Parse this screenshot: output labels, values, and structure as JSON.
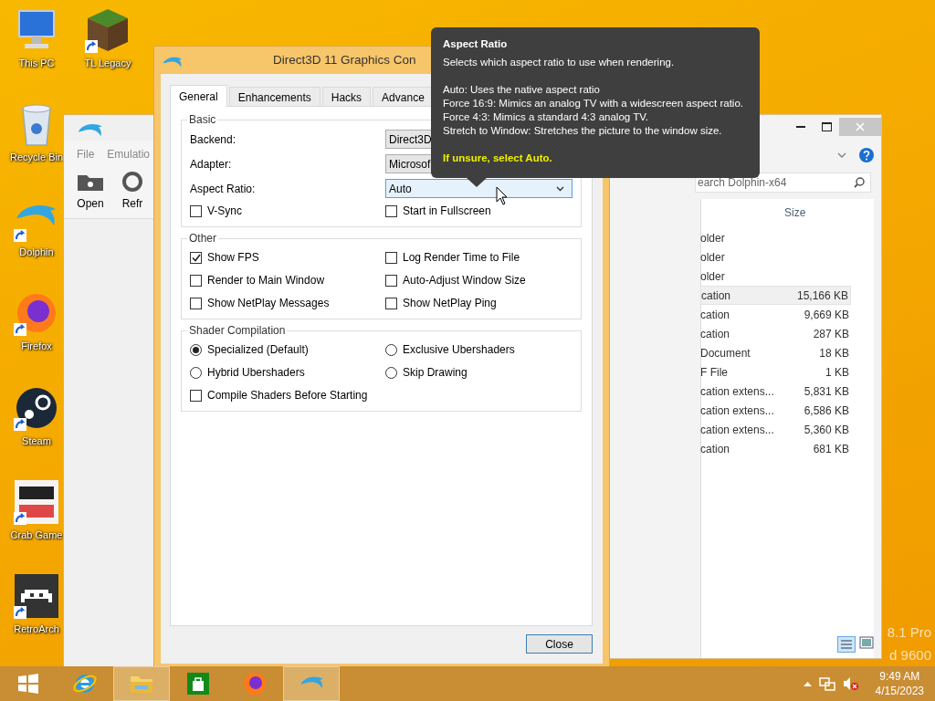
{
  "desktop_icons": [
    {
      "label": "This PC",
      "kind": "pc",
      "shortcut": false
    },
    {
      "label": "TL Legacy",
      "kind": "block",
      "shortcut": true
    },
    {
      "label": "Recycle Bin",
      "kind": "bin",
      "shortcut": false
    },
    {
      "label": "Dolphin",
      "kind": "dolphin",
      "shortcut": true
    },
    {
      "label": "Firefox",
      "kind": "firefox",
      "shortcut": true
    },
    {
      "label": "Steam",
      "kind": "steam",
      "shortcut": true
    },
    {
      "label": "Crab Game",
      "kind": "crab",
      "shortcut": true
    },
    {
      "label": "RetroArch",
      "kind": "retro",
      "shortcut": true
    }
  ],
  "os_build_text": [
    "8.1 Pro",
    "d 9600"
  ],
  "dolphin_window": {
    "menu": [
      "File",
      "Emulatio"
    ],
    "toolbar": [
      {
        "label": "Open",
        "kind": "open"
      },
      {
        "label": "Refr",
        "kind": "refresh"
      }
    ]
  },
  "explorer_window": {
    "search_placeholder": "earch Dolphin-x64",
    "columns": [
      "Size"
    ],
    "rows": [
      {
        "type": "older",
        "selected": false
      },
      {
        "type": "older",
        "selected": false
      },
      {
        "type": "older",
        "selected": false
      },
      {
        "type": "cation",
        "size": "15,166 KB",
        "selected": true
      },
      {
        "type": "cation",
        "size": "9,669 KB",
        "selected": false
      },
      {
        "type": "cation",
        "size": "287 KB",
        "selected": false
      },
      {
        "type": "Document",
        "size": "18 KB",
        "selected": false
      },
      {
        "type": "F File",
        "size": "1 KB",
        "selected": false
      },
      {
        "type": "cation extens...",
        "size": "5,831 KB",
        "selected": false
      },
      {
        "type": "cation extens...",
        "size": "6,586 KB",
        "selected": false
      },
      {
        "type": "cation extens...",
        "size": "5,360 KB",
        "selected": false
      },
      {
        "type": "cation",
        "size": "681 KB",
        "selected": false
      }
    ]
  },
  "dialog": {
    "title": "Direct3D 11 Graphics Con",
    "tabs": [
      {
        "label": "General",
        "selected": true
      },
      {
        "label": "Enhancements",
        "selected": false
      },
      {
        "label": "Hacks",
        "selected": false
      },
      {
        "label": "Advance",
        "selected": false
      }
    ],
    "groups": [
      {
        "title": "Basic",
        "items": [
          {
            "kind": "combo",
            "label": "Backend:",
            "value": "Direct3D",
            "hover": false
          },
          {
            "kind": "combo",
            "label": "Adapter:",
            "value": "Microsof",
            "hover": false
          },
          {
            "kind": "combo",
            "label": "Aspect Ratio:",
            "value": "Auto",
            "hover": true,
            "caret": true
          },
          {
            "kind": "checkbox",
            "label": "V-Sync",
            "checked": false
          },
          {
            "kind": "checkbox",
            "label": "Start in Fullscreen",
            "checked": false
          }
        ]
      },
      {
        "title": "Other",
        "items": [
          {
            "kind": "checkbox",
            "label": "Show FPS",
            "checked": true
          },
          {
            "kind": "checkbox",
            "label": "Log Render Time to File",
            "checked": false
          },
          {
            "kind": "checkbox",
            "label": "Render to Main Window",
            "checked": false
          },
          {
            "kind": "checkbox",
            "label": "Auto-Adjust Window Size",
            "checked": false
          },
          {
            "kind": "checkbox",
            "label": "Show NetPlay Messages",
            "checked": false
          },
          {
            "kind": "checkbox",
            "label": "Show NetPlay Ping",
            "checked": false
          }
        ]
      },
      {
        "title": "Shader Compilation",
        "items": [
          {
            "kind": "radio",
            "label": "Specialized (Default)",
            "selected": true
          },
          {
            "kind": "radio",
            "label": "Exclusive Ubershaders",
            "selected": false
          },
          {
            "kind": "radio",
            "label": "Hybrid Ubershaders",
            "selected": false
          },
          {
            "kind": "radio",
            "label": "Skip Drawing",
            "selected": false
          },
          {
            "kind": "checkbox",
            "label": "Compile Shaders Before Starting",
            "checked": false
          }
        ]
      }
    ],
    "close_button": "Close"
  },
  "tooltip": {
    "title": "Aspect Ratio",
    "intro": "Selects which aspect ratio to use when rendering.",
    "lines": [
      "Auto: Uses the native aspect ratio",
      "Force 16:9: Mimics an analog TV with a widescreen aspect ratio.",
      "Force 4:3: Mimics a standard 4:3 analog TV.",
      "Stretch to Window: Stretches the picture to the window size."
    ],
    "hint": "If unsure, select Auto."
  },
  "taskbar": {
    "apps": [
      {
        "kind": "start",
        "running": false
      },
      {
        "kind": "ie",
        "running": false
      },
      {
        "kind": "explorer",
        "running": true
      },
      {
        "kind": "store",
        "running": false
      },
      {
        "kind": "firefox",
        "running": false
      },
      {
        "kind": "dolphin",
        "running": true
      }
    ],
    "time": "9:49 AM",
    "date": "4/15/2023"
  }
}
